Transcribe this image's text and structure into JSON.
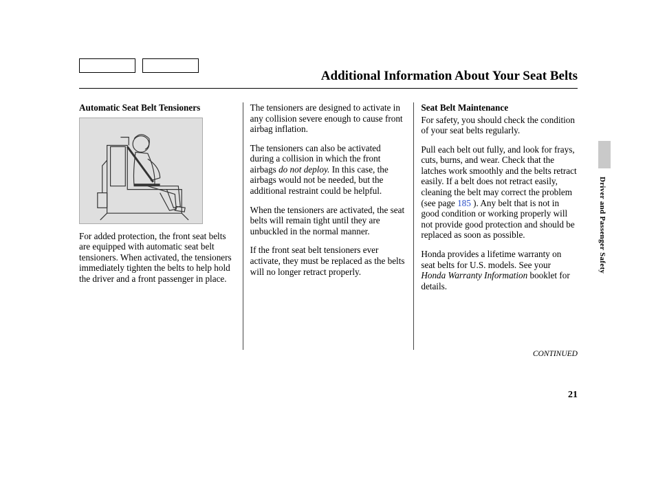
{
  "page_title": "Additional Information About Your Seat Belts",
  "side_label": "Driver and Passenger Safety",
  "page_number": "21",
  "continued": "CONTINUED",
  "col1": {
    "heading": "Automatic Seat Belt Tensioners",
    "p1": "For added protection, the front seat belts are equipped with automatic seat belt tensioners. When activated, the tensioners immediately tighten the belts to help hold the driver and a front passenger in place."
  },
  "col2": {
    "p1": "The tensioners are designed to activate in any collision severe enough to cause front airbag inflation.",
    "p2a": "The tensioners can also be activated during a collision in which the front airbags ",
    "p2_ital": "do not deploy.",
    "p2b": " In this case, the airbags would not be needed, but the additional restraint could be helpful.",
    "p3": "When the tensioners are activated, the seat belts will remain tight until they are unbuckled in the normal manner.",
    "p4": "If the front seat belt tensioners ever activate, they must be replaced as the belts will no longer retract properly."
  },
  "col3": {
    "heading": "Seat Belt Maintenance",
    "p1": "For safety, you should check the condition of your seat belts regularly.",
    "p2a": "Pull each belt out fully, and look for frays, cuts, burns, and wear. Check that the latches work smoothly and the belts retract easily. If a belt does not retract easily, cleaning the belt may correct the problem (see page ",
    "p2_link": "185",
    "p2b": " ). Any belt that is not in good condition or working properly will not provide good protection and should be replaced as soon as possible.",
    "p3a": "Honda provides a lifetime warranty on seat belts for U.S. models. See your ",
    "p3_ital": "Honda Warranty Information",
    "p3b": " booklet for details."
  }
}
